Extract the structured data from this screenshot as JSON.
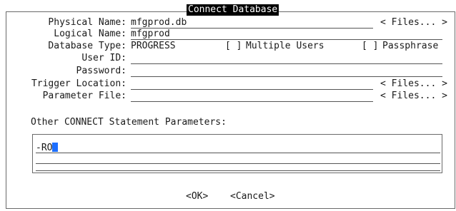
{
  "dialog": {
    "title": "Connect Database",
    "physical_name_label": "Physical Name:",
    "physical_name_value": "mfgprod.db",
    "logical_name_label": "Logical Name:",
    "logical_name_value": "mfgprod",
    "database_type_label": "Database Type:",
    "database_type_value": "PROGRESS",
    "multiple_users_checkbox": "[ ]",
    "multiple_users_label": "Multiple Users",
    "passphrase_checkbox": "[ ]",
    "passphrase_label": "Passphrase",
    "user_id_label": "User ID:",
    "user_id_value": "",
    "password_label": "Password:",
    "password_value": "",
    "trigger_location_label": "Trigger Location:",
    "trigger_location_value": "",
    "parameter_file_label": "Parameter File:",
    "parameter_file_value": "",
    "files_button_label": "< Files... >",
    "other_params_label": "Other CONNECT Statement Parameters:",
    "other_params_lines": [
      "-RO",
      "",
      ""
    ],
    "ok_label": "<OK>",
    "cancel_label": "<Cancel>"
  }
}
